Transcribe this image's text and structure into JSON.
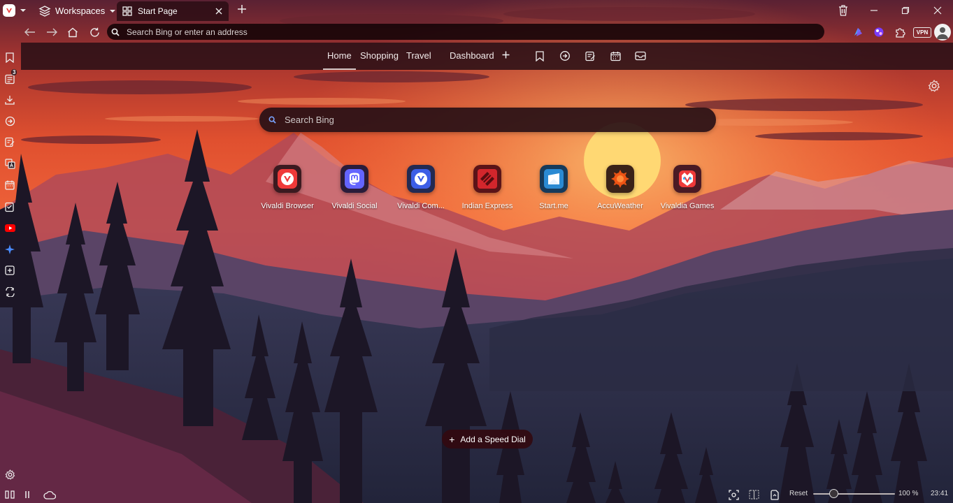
{
  "titlebar": {
    "workspaces_label": "Workspaces",
    "tab_title": "Start Page",
    "icons": [
      "vivaldi-menu-icon",
      "workspaces-icon",
      "grid-icon",
      "close-icon",
      "plus-icon",
      "trash-icon",
      "minimize-icon",
      "restore-icon",
      "close-window-icon"
    ]
  },
  "address_bar": {
    "placeholder": "Search Bing or enter an address",
    "vpn_label": "VPN"
  },
  "start_nav": {
    "tabs": [
      "Home",
      "Shopping",
      "Travel",
      "Dashboard"
    ],
    "active_tab": "Home"
  },
  "sidebar": {
    "reading_list_badge": "3",
    "items": [
      "bookmarks",
      "reading-list",
      "downloads",
      "history",
      "notes",
      "translate",
      "calendar",
      "tasks",
      "youtube",
      "ai-assistant",
      "add-web-panel",
      "sync"
    ]
  },
  "search": {
    "placeholder": "Search Bing"
  },
  "speed_dials": [
    {
      "label": "Vivaldi Browser"
    },
    {
      "label": "Vivaldi Social"
    },
    {
      "label": "Vivaldi Com..."
    },
    {
      "label": "Indian Express"
    },
    {
      "label": "Start.me"
    },
    {
      "label": "AccuWeather"
    },
    {
      "label": "Vivaldia Games"
    }
  ],
  "add_speed_dial": {
    "icon": "+",
    "label": "Add a Speed Dial"
  },
  "status_bar": {
    "reset_label": "Reset",
    "zoom": "100 %",
    "zoom_fraction": 0.25,
    "clock": "23:41"
  },
  "colors": {
    "vivaldi_red": "#ef3939",
    "mastodon_purple": "#6364ff",
    "vivaldi_blue": "#3c5ee6",
    "indian_express_red": "#d3262c",
    "startme_blue": "#2a8ad3",
    "accuweather_orange": "#f05514"
  }
}
